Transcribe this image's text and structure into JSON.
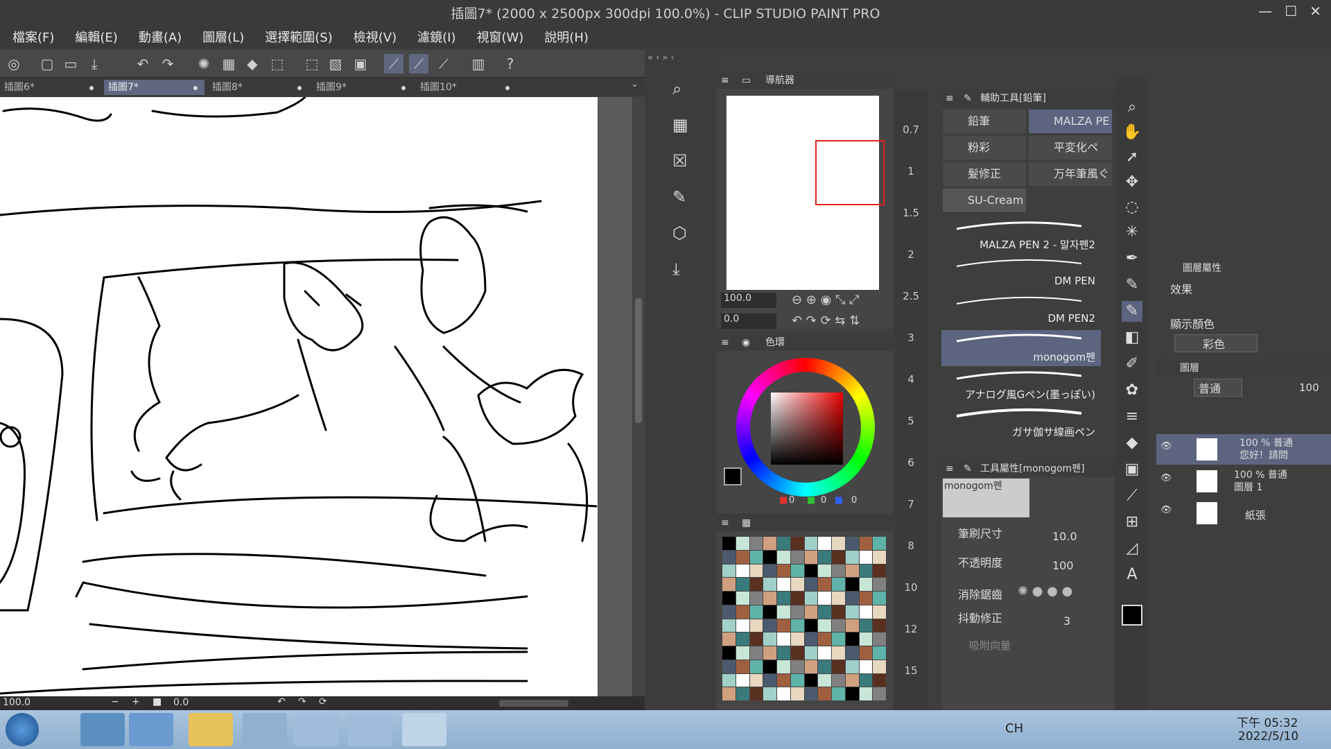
{
  "window": {
    "title": "插圖7* (2000 x 2500px 300dpi 100.0%)  - CLIP STUDIO PAINT PRO"
  },
  "menu": [
    "檔案(F)",
    "編輯(E)",
    "動畫(A)",
    "圖層(L)",
    "選擇範圍(S)",
    "檢視(V)",
    "濾鏡(I)",
    "視窗(W)",
    "說明(H)"
  ],
  "tabs": [
    {
      "label": "插圖6*"
    },
    {
      "label": "插圖7*"
    },
    {
      "label": "插圖8*"
    },
    {
      "label": "插圖9*"
    },
    {
      "label": "插圖10*"
    }
  ],
  "status": {
    "zoom": "100.0",
    "angle": "0.0"
  },
  "navigator": {
    "title": "導航器",
    "zoom": "100.0",
    "angle": "0.0"
  },
  "color": {
    "title": "色環",
    "r": "0",
    "g": "0",
    "b": "0"
  },
  "ruler": {
    "labels": [
      "0.7",
      "1",
      "1.5",
      "2",
      "2.5",
      "3",
      "4",
      "5",
      "6",
      "7",
      "8",
      "10",
      "12",
      "15"
    ]
  },
  "subtool": {
    "title": "輔助工具[鉛筆]",
    "groups": [
      "鉛筆",
      "粉彩",
      "髮修正",
      "SU-Cream",
      "MALZA PE",
      "平変化ペ",
      "万年筆風ぐ"
    ],
    "brushes": [
      "MALZA PEN 2 - 말자펜2",
      "DM PEN",
      "DM PEN2",
      "monogom펜",
      "アナログ風Gペン(墨っぽい)",
      "ガサ伽サ線画ペン"
    ]
  },
  "toolprops": {
    "title": "工具屬性[monogom펜]",
    "preview_label": "monogom펜",
    "brush_size_label": "筆刷尺寸",
    "brush_size": "10.0",
    "opacity_label": "不透明度",
    "opacity": "100",
    "aa_label": "消除鋸齒",
    "stab_label": "抖動修正",
    "stab": "3",
    "vector_label": "吸附向量"
  },
  "layerprops": {
    "title": "圖層屬性",
    "effect_label": "效果",
    "color_label": "顯示顏色",
    "color_value": "彩色"
  },
  "layers": {
    "title": "圖層",
    "blend": "普通",
    "opacity": "100",
    "items": [
      {
        "line1": "100 % 普通",
        "line2": "您好！請問"
      },
      {
        "line1": "100 % 普通",
        "line2": "圖層 1"
      },
      {
        "line1": "",
        "line2": "紙張"
      }
    ]
  },
  "taskbar": {
    "lang": "CH",
    "time": "下午 05:32",
    "date": "2022/5/10"
  }
}
